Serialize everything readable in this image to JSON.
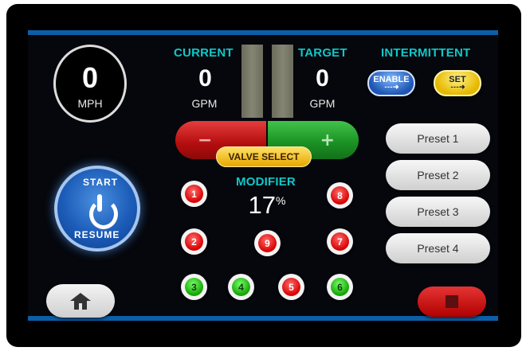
{
  "speed": {
    "value": "0",
    "unit": "MPH"
  },
  "flow": {
    "current_label": "CURRENT",
    "current_value": "0",
    "current_unit": "GPM",
    "target_label": "TARGET",
    "target_value": "0",
    "target_unit": "GPM"
  },
  "intermittent": {
    "label": "INTERMITTENT",
    "enable_label": "ENABLE",
    "set_label": "SET"
  },
  "valve": {
    "minus_label": "−",
    "plus_label": "+",
    "select_label": "VALVE SELECT"
  },
  "modifier": {
    "label": "MODIFIER",
    "value": "17",
    "unit": "%"
  },
  "valves": [
    {
      "label": "1",
      "state": "red"
    },
    {
      "label": "8",
      "state": "red"
    },
    {
      "label": "2",
      "state": "red"
    },
    {
      "label": "9",
      "state": "red"
    },
    {
      "label": "7",
      "state": "red"
    },
    {
      "label": "3",
      "state": "green"
    },
    {
      "label": "4",
      "state": "green"
    },
    {
      "label": "5",
      "state": "red"
    },
    {
      "label": "6",
      "state": "green"
    }
  ],
  "start_button": {
    "top_text": "START",
    "bottom_text": "RESUME"
  },
  "presets": [
    "Preset 1",
    "Preset 2",
    "Preset 3",
    "Preset 4"
  ],
  "icons": {
    "home": "home-icon",
    "stop": "stop-icon",
    "power": "power-icon"
  }
}
